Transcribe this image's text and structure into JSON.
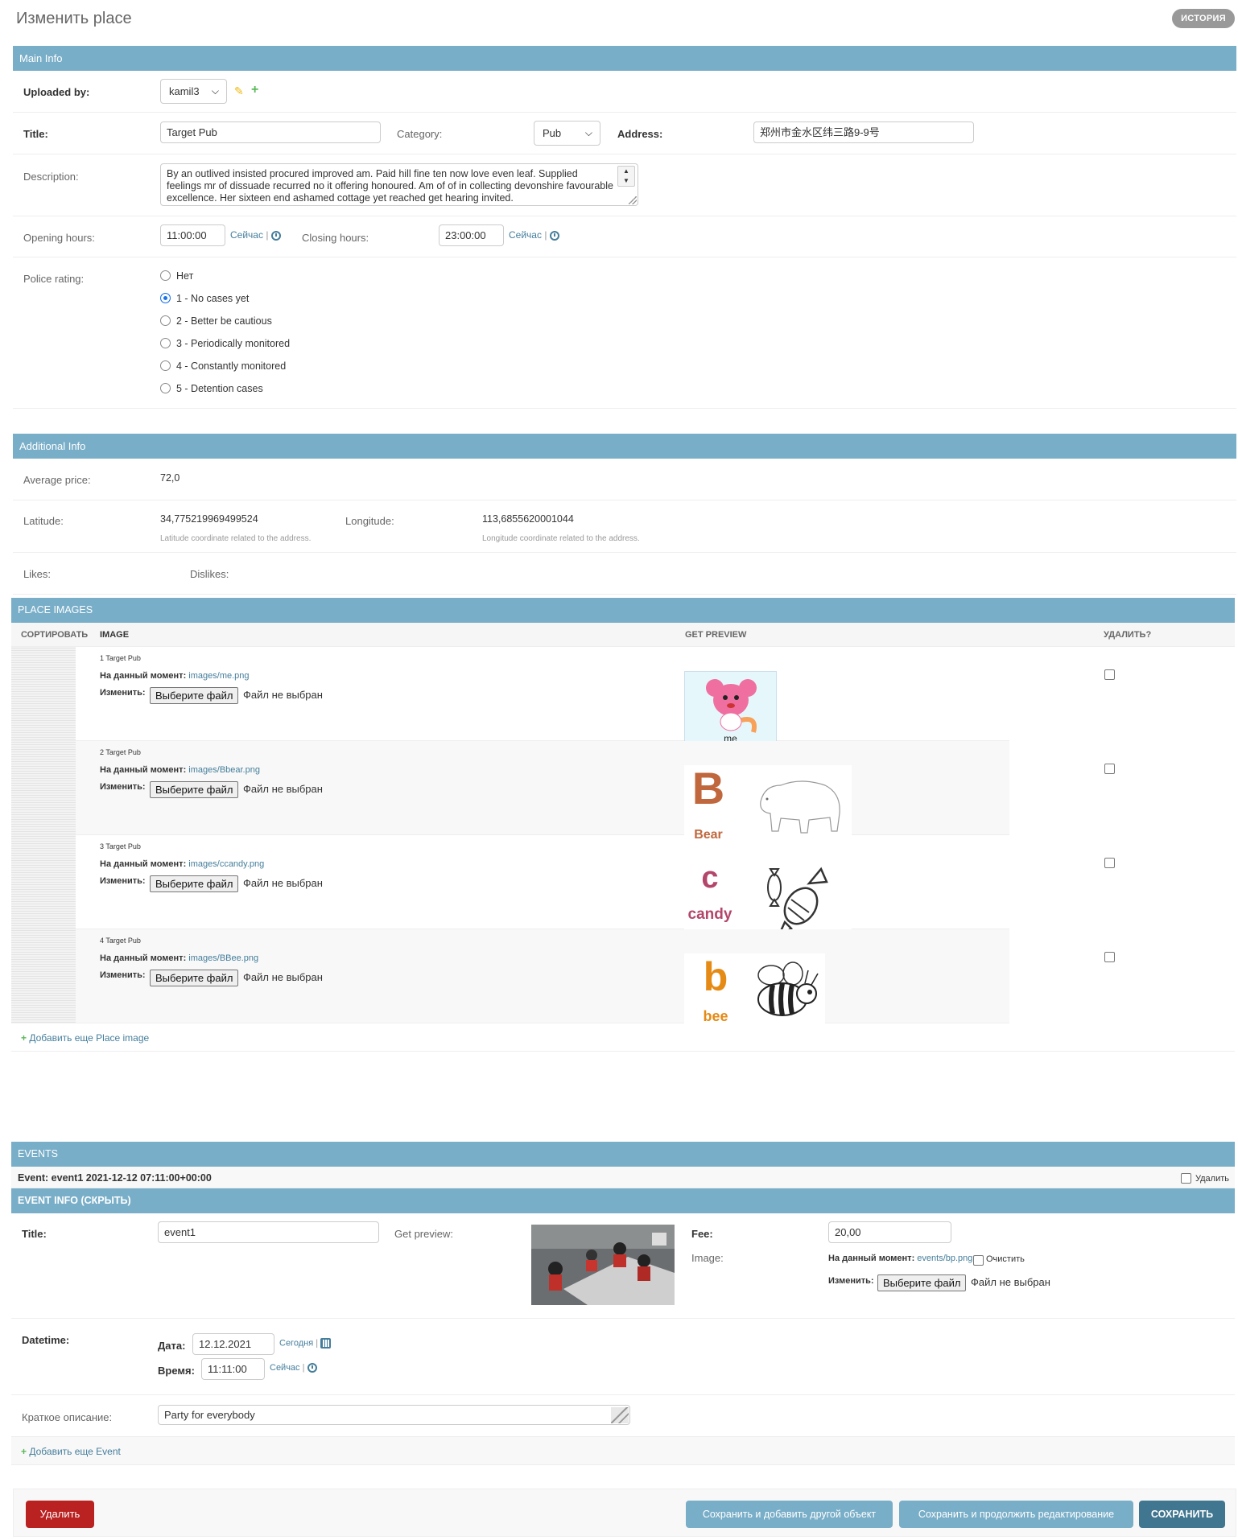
{
  "header": {
    "title": "Изменить place",
    "history_button": "История"
  },
  "main_info": {
    "section_title": "Main Info",
    "uploaded_by": {
      "label": "Uploaded by:",
      "value": "kamil3"
    },
    "title": {
      "label": "Title:",
      "value": "Target Pub"
    },
    "category": {
      "label": "Category:",
      "value": "Pub"
    },
    "address": {
      "label": "Address:",
      "value": "郑州市金水区纬三路9-9号"
    },
    "description": {
      "label": "Description:",
      "value": "By an outlived insisted procured improved am. Paid hill fine ten now love even leaf. Supplied feelings mr of dissuade recurred no it offering honoured. Am of of in collecting devonshire favourable excellence. Her sixteen end ashamed cottage yet reached get hearing invited."
    },
    "opening_hours": {
      "label": "Opening hours:",
      "value": "11:00:00",
      "now_link": "Сейчас",
      "separator": "|"
    },
    "closing_hours": {
      "label": "Closing hours:",
      "value": "23:00:00",
      "now_link": "Сейчас",
      "separator": "|"
    },
    "police_rating": {
      "label": "Police rating:",
      "options": [
        "Нет",
        "1 - No cases yet",
        "2 - Better be cautious",
        "3 - Periodically monitored",
        "4 - Constantly monitored",
        "5 - Detention cases"
      ],
      "selected_index": 1
    }
  },
  "additional_info": {
    "section_title": "Additional Info",
    "average_price": {
      "label": "Average price:",
      "value": "72,0"
    },
    "latitude": {
      "label": "Latitude:",
      "value": "34,775219969499524",
      "help": "Latitude coordinate related to the address."
    },
    "longitude": {
      "label": "Longitude:",
      "value": "113,6855620001044",
      "help": "Longitude coordinate related to the address."
    },
    "likes": {
      "label": "Likes:"
    },
    "dislikes": {
      "label": "Dislikes:"
    }
  },
  "place_images": {
    "section_title": "Place Images",
    "columns": [
      "Сортировать",
      "Image",
      "Get preview",
      "Удалить?"
    ],
    "current_label": "На данный момент:",
    "change_label": "Изменить:",
    "file_button": "Выберите файл",
    "no_file": "Файл не выбран",
    "rows": [
      {
        "caption": "1 Target Pub",
        "path": "images/me.png",
        "preview_text": "me"
      },
      {
        "caption": "2 Target Pub",
        "path": "images/Bbear.png",
        "preview_letter": "B",
        "preview_word": "Bear"
      },
      {
        "caption": "3 Target Pub",
        "path": "images/ccandy.png",
        "preview_letter": "c",
        "preview_word": "candy"
      },
      {
        "caption": "4 Target Pub",
        "path": "images/BBee.png",
        "preview_letter": "b",
        "preview_word": "bee"
      }
    ],
    "add_link": "Добавить еще Place image"
  },
  "events": {
    "section_title": "Events",
    "event_row_title": "Event: event1 2021-12-12 07:11:00+00:00",
    "delete_label": "Удалить",
    "event_info_title": "Event info (Скрыть)",
    "title": {
      "label": "Title:",
      "value": "event1"
    },
    "get_preview_label": "Get preview:",
    "fee": {
      "label": "Fee:",
      "value": "20,00"
    },
    "image": {
      "label": "Image:",
      "current_label": "На данный момент:",
      "path": "events/bp.png",
      "clear_label": "Очистить",
      "change_label": "Изменить:",
      "file_button": "Выберите файл",
      "no_file": "Файл не выбран"
    },
    "datetime": {
      "label": "Datetime:",
      "date_label": "Дата:",
      "date_value": "12.12.2021",
      "today_link": "Сегодня",
      "time_label": "Время:",
      "time_value": "11:11:00",
      "now_link": "Сейчас",
      "separator": "|"
    },
    "short_description": {
      "label": "Краткое описание:",
      "value": "Party for everybody"
    },
    "add_link": "Добавить еще Event"
  },
  "submit_row": {
    "delete": "Удалить",
    "save_add": "Сохранить и добавить другой объект",
    "save_continue": "Сохранить и продолжить редактирование",
    "save": "Сохранить"
  },
  "colors": {
    "section_header": "#79aec8",
    "link": "#447e9b",
    "delete_button": "#ba2121",
    "save_button": "#417690",
    "secondary_button": "#79aec8"
  }
}
